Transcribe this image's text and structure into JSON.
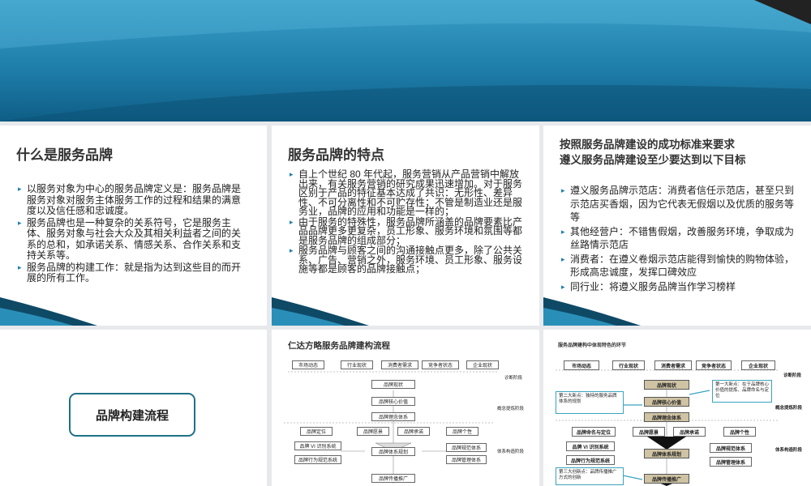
{
  "slide1": {
    "title": "什么是服务品牌",
    "bullets": [
      "以服务对象为中心的服务品牌定义是：服务品牌是服务对象对服务主体服务工作的过程和结果的满意度以及信任感和忠诚度。",
      "服务品牌也是一种复杂的关系符号，它是服务主体、服务对象与社会大众及其相关利益者之间的关系的总和，如承诺关系、情感关系、合作关系和支持关系等。",
      "服务品牌的构建工作：就是指为达到这些目的而开展的所有工作。"
    ]
  },
  "slide2": {
    "title": "服务品牌的特点",
    "bullets": [
      "自上个世纪 80 年代起，服务营销从产品营销中解放出来，有关服务营销的研究成果迅速增加。对于服务区别于产品的特征基本达成了共识：无形性、差异性、不可分离性和不可贮存性；不管是制造业还是服务业，品牌的应用和功能是一样的；",
      "由于服务的特殊性，服务品牌所涵盖的品牌要素比产品品牌更多更复杂，员工形象、服务环境和氛围等都是服务品牌的组成部分；",
      "服务品牌与顾客之间的沟通接触点更多，除了公共关系、广告、营销之外，服务环境、员工形象、服务设施等都是顾客的品牌接触点；"
    ]
  },
  "slide3": {
    "title_line1": "按照服务品牌建设的成功标准来要求",
    "title_line2": "遵义服务品牌建设至少要达到以下目标",
    "bullets": [
      "遵义服务品牌示范店：消费者信任示范店，甚至只到示范店买香烟，因为它代表无假烟以及优质的服务等等",
      "其他经营户：不错售假烟，改善服务环境，争取成为丝路情示范店",
      "消费者：在遵义卷烟示范店能得到愉快的购物体验，形成高忠诚度，发挥口碑效应",
      "同行业：将遵义服务品牌当作学习榜样"
    ]
  },
  "slide4": {
    "button_label": "品牌构建流程"
  },
  "slide5": {
    "title": "仁达方略服务品牌建构流程",
    "top_row": [
      "市场动态",
      "行业现状",
      "消费者需求",
      "竞争者状态",
      "企业现状"
    ],
    "stages": [
      "诊断阶段",
      "概念提炼阶段",
      "体系构造阶段"
    ],
    "center": [
      "品牌现状",
      "品牌核心价值",
      "品牌理念体系",
      "品牌体系规划",
      "品牌传播推广"
    ],
    "mid_row": [
      "品牌定位",
      "品牌愿景",
      "品牌承诺",
      "品牌个性"
    ],
    "left": [
      "品牌 VI 识别系统",
      "品牌行为规范系统"
    ],
    "right": [
      "品牌规范体系",
      "品牌管理体系"
    ]
  },
  "slide6": {
    "title": "服务品牌建构中体现特色的环节",
    "top_row": [
      "市场动态",
      "行业现状",
      "消费者需求",
      "竞争者状态",
      "企业现状"
    ],
    "stages": [
      "诊断阶段",
      "概念提炼阶段",
      "体系构造阶段"
    ],
    "center": [
      "品牌现状",
      "品牌核心价值",
      "品牌理念体系",
      "品牌体系规划",
      "品牌传播推广"
    ],
    "mid_row": [
      "品牌命名与定位",
      "品牌愿景",
      "品牌承诺",
      "品牌个性"
    ],
    "left": [
      "品牌 VI 识别系统",
      "品牌行为规范系统"
    ],
    "right": [
      "品牌规范体系",
      "品牌管理体系"
    ],
    "notes": [
      "第一大新点：在于品牌核心价值的提炼、品牌命名与定位",
      "第二大新点：独特的服务品牌体系的规划",
      "第三大创新点：品牌传播推广方式的创新"
    ]
  },
  "colors": {
    "accent": "#1b7fb0",
    "banner": "#1f7fab",
    "note_border": "#3aa3bd"
  }
}
